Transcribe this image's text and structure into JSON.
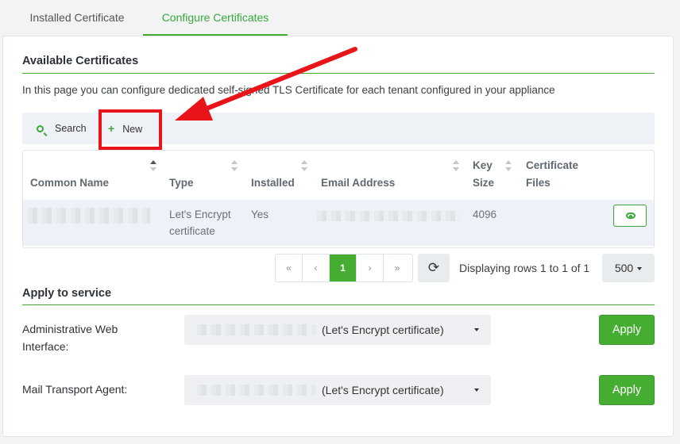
{
  "tabs": [
    {
      "label": "Installed Certificate"
    },
    {
      "label": "Configure Certificates"
    }
  ],
  "available": {
    "title": "Available Certificates",
    "description": "In this page you can configure dedicated self-signed TLS Certificate for each tenant configured in your appliance"
  },
  "toolbar": {
    "search_label": "Search",
    "new_label": "New"
  },
  "table": {
    "headers": {
      "common_name": "Common Name",
      "type": "Type",
      "installed": "Installed",
      "email": "Email Address",
      "key_size_1": "Key",
      "key_size_2": "Size",
      "cert_files_1": "Certificate",
      "cert_files_2": "Files"
    },
    "rows": [
      {
        "type_1": "Let's Encrypt",
        "type_2": "certificate",
        "installed": "Yes",
        "key_size": "4096"
      }
    ]
  },
  "pagination": {
    "first": "«",
    "prev": "‹",
    "page": "1",
    "next": "›",
    "last": "»",
    "refresh": "⟳",
    "rows_text": "Displaying rows 1 to 1 of 1",
    "page_size": "500"
  },
  "apply_service": {
    "title": "Apply to service",
    "services": [
      {
        "label_1": "Administrative Web",
        "label_2": "Interface:",
        "selected": "(Let's Encrypt certificate)",
        "apply_label": "Apply"
      },
      {
        "label_1": "Mail Transport Agent:",
        "selected": "(Let's Encrypt certificate)",
        "apply_label": "Apply"
      }
    ]
  },
  "colors": {
    "accent": "#46ad33",
    "annotation": "#e8141a"
  },
  "icons": {
    "search": "search-icon",
    "new": "plus-icon",
    "view": "eye-icon",
    "refresh": "refresh-icon"
  }
}
